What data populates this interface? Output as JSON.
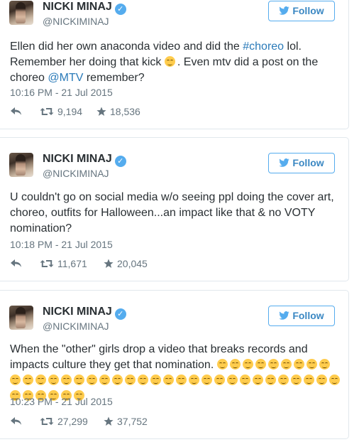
{
  "tweets": [
    {
      "name": "NICKI MINAJ",
      "handle": "@NICKIMINAJ",
      "follow_label": "Follow",
      "text_parts": [
        "Ellen did her own anaconda video and did the ",
        "#choreo",
        " lol. Remember her doing that kick ",
        ". Even mtv did a post on the choreo ",
        "@MTV",
        " remember?"
      ],
      "time": "10:16 PM - 21 Jul 2015",
      "retweets": "9,194",
      "likes": "18,536"
    },
    {
      "name": "NICKI MINAJ",
      "handle": "@NICKIMINAJ",
      "follow_label": "Follow",
      "text": "U couldn't go on social media w/o seeing ppl doing the cover art, choreo, outfits for Halloween...an impact like that & no VOTY nomination?",
      "time": "10:18 PM - 21 Jul 2015",
      "retweets": "11,671",
      "likes": "20,045"
    },
    {
      "name": "NICKI MINAJ",
      "handle": "@NICKIMINAJ",
      "follow_label": "Follow",
      "text": "When the \"other\" girls drop a video that breaks records and impacts culture they get that nomination.",
      "emoji_count": 41,
      "time": "10:23 PM - 21 Jul 2015",
      "retweets": "27,299",
      "likes": "37,752"
    }
  ],
  "icons": {
    "verified": "verified-badge-icon",
    "follow": "twitter-bird-icon",
    "reply": "reply-icon",
    "retweet": "retweet-icon",
    "like": "star-icon",
    "emoji_tired": "tired-face-emoji",
    "emoji_smile": "smiling-face-emoji"
  },
  "colors": {
    "link": "#2b7bb9",
    "follow_border": "#55acee",
    "follow_text": "#3b88c3",
    "verified": "#55acee",
    "muted": "#66757f"
  }
}
